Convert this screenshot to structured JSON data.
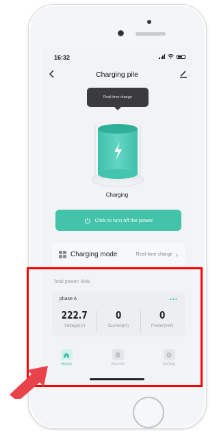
{
  "status_bar": {
    "time": "16:32"
  },
  "nav": {
    "title": "Charging pile"
  },
  "tooltip": {
    "text": "Real-time charge"
  },
  "charging": {
    "status": "Charging"
  },
  "power_button": {
    "label": "Click to turn off the power"
  },
  "mode": {
    "label": "Charging mode",
    "value": "Real-time charge"
  },
  "total_power": {
    "text": "Total power:  0kW"
  },
  "phase": {
    "name": "phase A",
    "metrics": [
      {
        "value": "222.7",
        "label": "Voltage(V)"
      },
      {
        "value": "0",
        "label": "Current(A)"
      },
      {
        "value": "0",
        "label": "Power(kW)"
      }
    ]
  },
  "tabs": [
    {
      "label": "Home",
      "icon": "home-icon",
      "active": true
    },
    {
      "label": "Record",
      "icon": "record-icon",
      "active": false
    },
    {
      "label": "Setting",
      "icon": "setting-icon",
      "active": false
    }
  ],
  "colors": {
    "accent": "#44c3ab",
    "highlight": "#ff0000",
    "arrow": "#e8424a"
  }
}
